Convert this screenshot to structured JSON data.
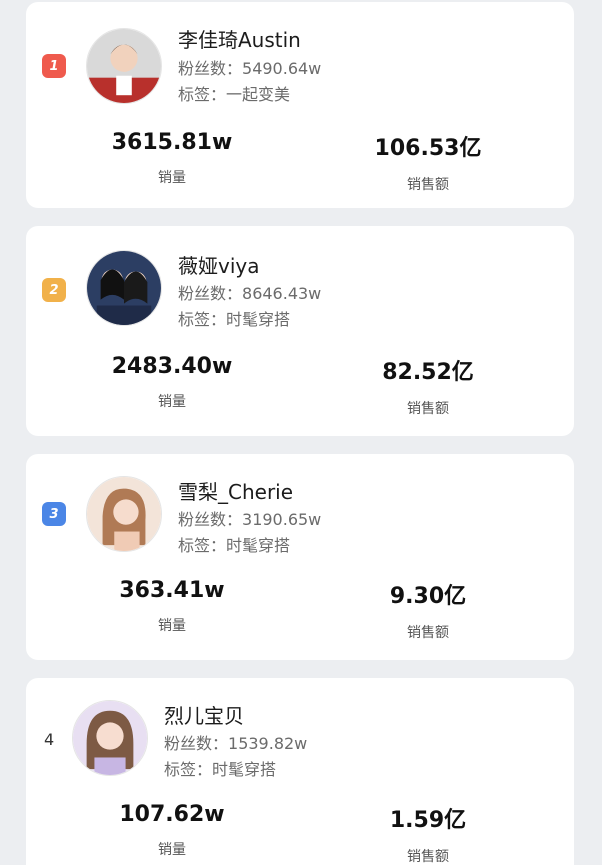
{
  "streamers": [
    {
      "rank": "1",
      "name": "李佳琦Austin",
      "followers_label": "粉丝数：",
      "followers": "5490.64w",
      "tag_label": "标签：",
      "tag": "一起变美",
      "sales_value": "3615.81w",
      "sales_label": "销量",
      "revenue_value": "106.53亿",
      "revenue_label": "销售额"
    },
    {
      "rank": "2",
      "name": "薇娅viya",
      "followers_label": "粉丝数：",
      "followers": "8646.43w",
      "tag_label": "标签：",
      "tag": "时髦穿搭",
      "sales_value": "2483.40w",
      "sales_label": "销量",
      "revenue_value": "82.52亿",
      "revenue_label": "销售额"
    },
    {
      "rank": "3",
      "name": "雪梨_Cherie",
      "followers_label": "粉丝数：",
      "followers": "3190.65w",
      "tag_label": "标签：",
      "tag": "时髦穿搭",
      "sales_value": "363.41w",
      "sales_label": "销量",
      "revenue_value": "9.30亿",
      "revenue_label": "销售额"
    },
    {
      "rank": "4",
      "name": "烈儿宝贝",
      "followers_label": "粉丝数：",
      "followers": "1539.82w",
      "tag_label": "标签：",
      "tag": "时髦穿搭",
      "sales_value": "107.62w",
      "sales_label": "销量",
      "revenue_value": "1.59亿",
      "revenue_label": "销售额"
    }
  ],
  "colors": {
    "rank1": "#ef5a4d",
    "rank2": "#f1b14a",
    "rank3": "#4b86e6"
  }
}
